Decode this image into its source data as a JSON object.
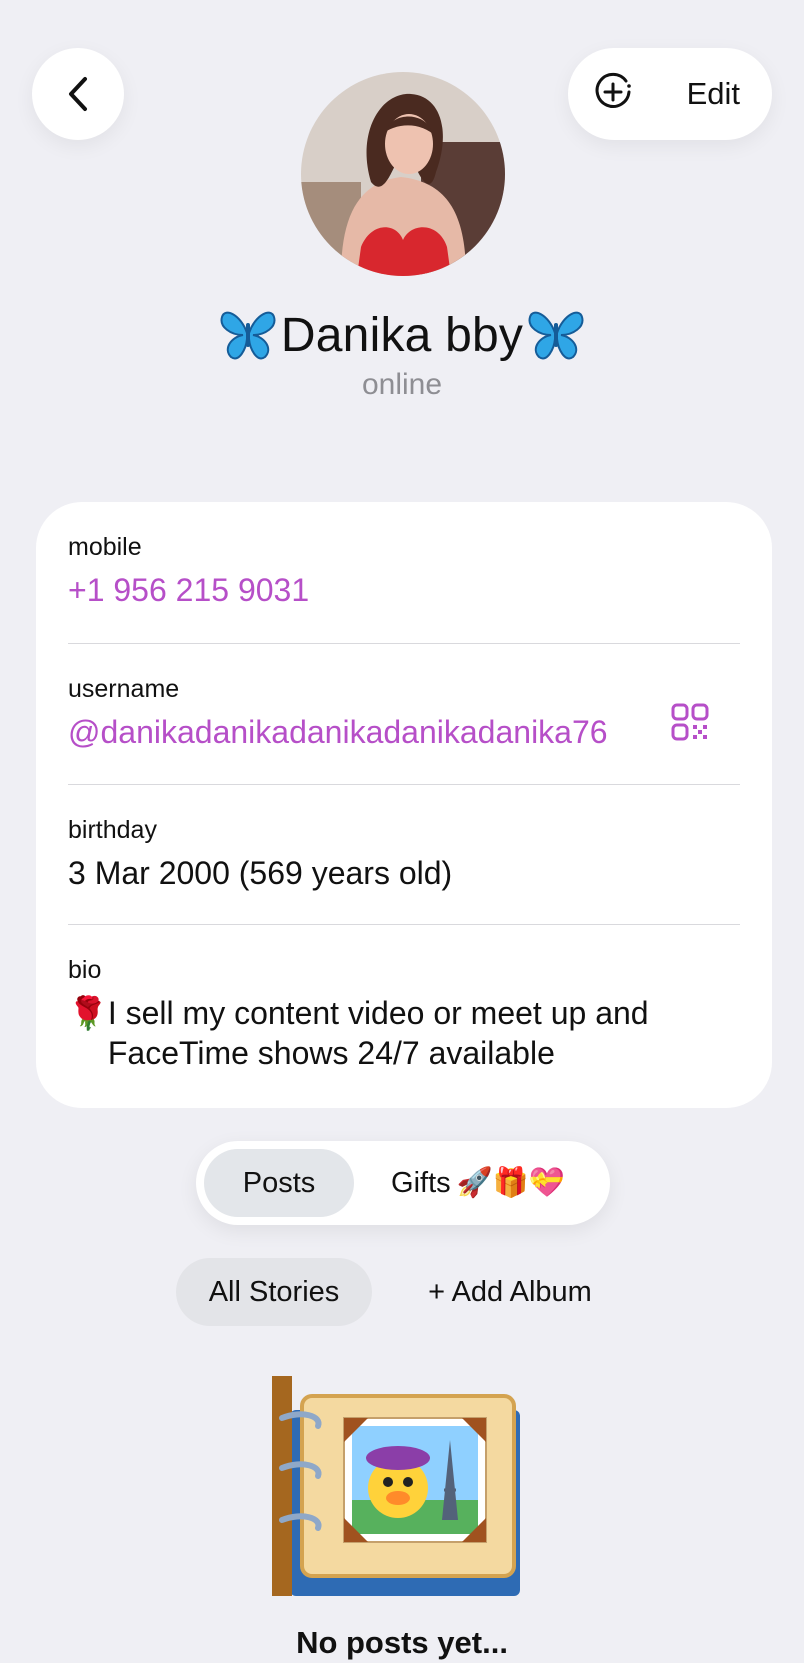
{
  "header": {
    "edit_label": "Edit",
    "back_icon": "chevron-left-icon",
    "add_story_icon": "add-circle-icon"
  },
  "profile": {
    "name": "Danika bby",
    "name_decoration_icon": "butterfly-icon",
    "status": "online"
  },
  "info": {
    "mobile": {
      "label": "mobile",
      "value": "+1 956 215 9031"
    },
    "username": {
      "label": "username",
      "value": "@danikadanikadanikadanikadanika76",
      "icon": "qr-code-icon"
    },
    "birthday": {
      "label": "birthday",
      "value": "3 Mar 2000 (569 years old)"
    },
    "bio": {
      "label": "bio",
      "emoji": "🌹",
      "value": "I sell my content video or meet up and FaceTime shows 24/7 available"
    }
  },
  "tabs": {
    "posts": "Posts",
    "gifts": "Gifts",
    "gifts_emojis": "🚀🎁💝"
  },
  "filters": {
    "all_stories": "All Stories",
    "add_album": "+ Add Album"
  },
  "empty_state": {
    "text": "No posts yet..."
  },
  "colors": {
    "background": "#efeff4",
    "card": "#ffffff",
    "link": "#b64fc8",
    "secondary_text": "#8e8e93",
    "selected_tab": "#e3e6ea"
  }
}
